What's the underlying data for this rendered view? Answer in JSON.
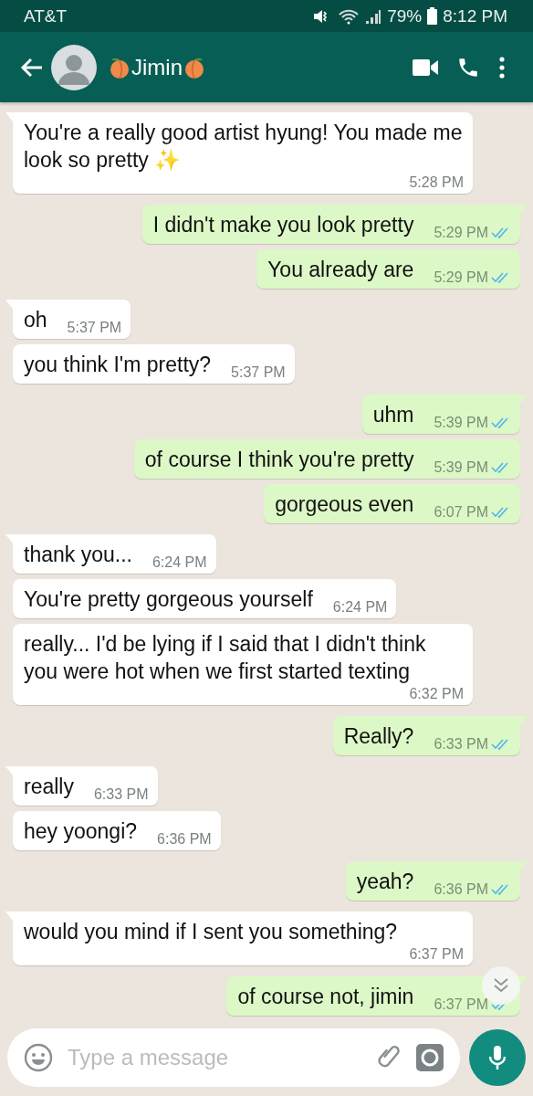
{
  "status_bar": {
    "carrier": "AT&T",
    "battery": "79%",
    "time": "8:12 PM"
  },
  "header": {
    "title": "Jimin"
  },
  "messages": [
    {
      "kind": "in",
      "text": "You're a really good artist hyung! You made me look so pretty ✨",
      "time": "5:28 PM"
    },
    {
      "kind": "out",
      "text": "I didn't make you look pretty",
      "time": "5:29 PM",
      "read": true
    },
    {
      "kind": "out",
      "text": "You already are",
      "time": "5:29 PM",
      "read": true
    },
    {
      "kind": "in",
      "text": "oh",
      "time": "5:37 PM"
    },
    {
      "kind": "in",
      "text": "you think I'm pretty?",
      "time": "5:37 PM"
    },
    {
      "kind": "out",
      "text": "uhm",
      "time": "5:39 PM",
      "read": true
    },
    {
      "kind": "out",
      "text": "of course I think you're pretty",
      "time": "5:39 PM",
      "read": true
    },
    {
      "kind": "out",
      "text": "gorgeous even",
      "time": "6:07 PM",
      "read": true
    },
    {
      "kind": "in",
      "text": "thank you...",
      "time": "6:24 PM"
    },
    {
      "kind": "in",
      "text": "You're pretty gorgeous yourself",
      "time": "6:24 PM"
    },
    {
      "kind": "in",
      "text": "really... I'd be lying if I said that I didn't think you were hot when we first started texting",
      "time": "6:32 PM"
    },
    {
      "kind": "out",
      "text": "Really?",
      "time": "6:33 PM",
      "read": true
    },
    {
      "kind": "in",
      "text": "really",
      "time": "6:33 PM"
    },
    {
      "kind": "in",
      "text": "hey yoongi?",
      "time": "6:36 PM"
    },
    {
      "kind": "out",
      "text": "yeah?",
      "time": "6:36 PM",
      "read": true
    },
    {
      "kind": "in",
      "text": "would you mind if I sent you something?",
      "time": "6:37 PM"
    },
    {
      "kind": "out",
      "text": "of course not, jimin",
      "time": "6:37 PM",
      "read": true
    }
  ],
  "composer": {
    "placeholder": "Type a message"
  }
}
